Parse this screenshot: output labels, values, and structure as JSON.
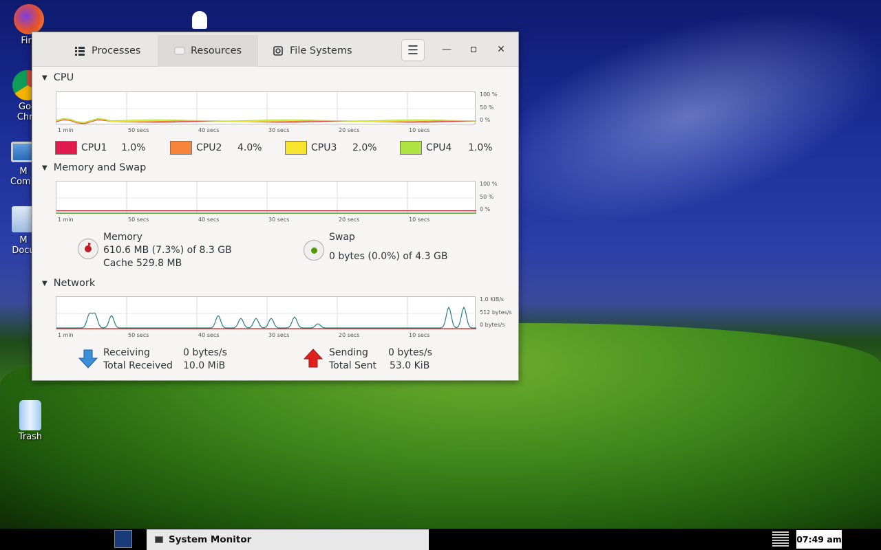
{
  "desktop": {
    "icons": [
      {
        "label": "Fire"
      },
      {
        "label": "Goo Chro"
      },
      {
        "label": "M Comp"
      },
      {
        "label": "M Docu"
      },
      {
        "label": "Trash"
      }
    ]
  },
  "window": {
    "tabs": [
      {
        "label": "Processes",
        "icon": "list-icon"
      },
      {
        "label": "Resources",
        "icon": "resources-icon"
      },
      {
        "label": "File Systems",
        "icon": "disk-icon"
      }
    ],
    "active_tab": "Resources"
  },
  "cpu": {
    "title": "CPU",
    "y_labels": [
      "100 %",
      "50 %",
      "0 %"
    ],
    "x_labels": [
      "1 min",
      "50 secs",
      "40 secs",
      "30 secs",
      "20 secs",
      "10 secs"
    ],
    "cores": [
      {
        "name": "CPU1",
        "value": "1.0%",
        "color": "#e01b4b"
      },
      {
        "name": "CPU2",
        "value": "4.0%",
        "color": "#f6853a"
      },
      {
        "name": "CPU3",
        "value": "2.0%",
        "color": "#f8e42e"
      },
      {
        "name": "CPU4",
        "value": "1.0%",
        "color": "#aee241"
      }
    ]
  },
  "memory": {
    "title": "Memory and Swap",
    "y_labels": [
      "100 %",
      "50 %",
      "0 %"
    ],
    "x_labels": [
      "1 min",
      "50 secs",
      "40 secs",
      "30 secs",
      "20 secs",
      "10 secs"
    ],
    "memory_label": "Memory",
    "memory_usage": "610.6 MB (7.3%) of 8.3 GB",
    "cache": "Cache 529.8 MB",
    "memory_fraction": 0.073,
    "swap_label": "Swap",
    "swap_usage": "0 bytes (0.0%) of 4.3 GB",
    "swap_fraction": 0.0
  },
  "network": {
    "title": "Network",
    "y_labels": [
      "1.0 KiB/s",
      "512 bytes/s",
      "0 bytes/s"
    ],
    "x_labels": [
      "1 min",
      "50 secs",
      "40 secs",
      "30 secs",
      "20 secs",
      "10 secs"
    ],
    "receiving_label": "Receiving",
    "receiving_value": "0 bytes/s",
    "total_received_label": "Total Received",
    "total_received_value": "10.0 MiB",
    "sending_label": "Sending",
    "sending_value": "0 bytes/s",
    "total_sent_label": "Total Sent",
    "total_sent_value": "53.0 KiB"
  },
  "taskbar": {
    "task_label": "System Monitor",
    "clock": "07:49 am"
  }
}
